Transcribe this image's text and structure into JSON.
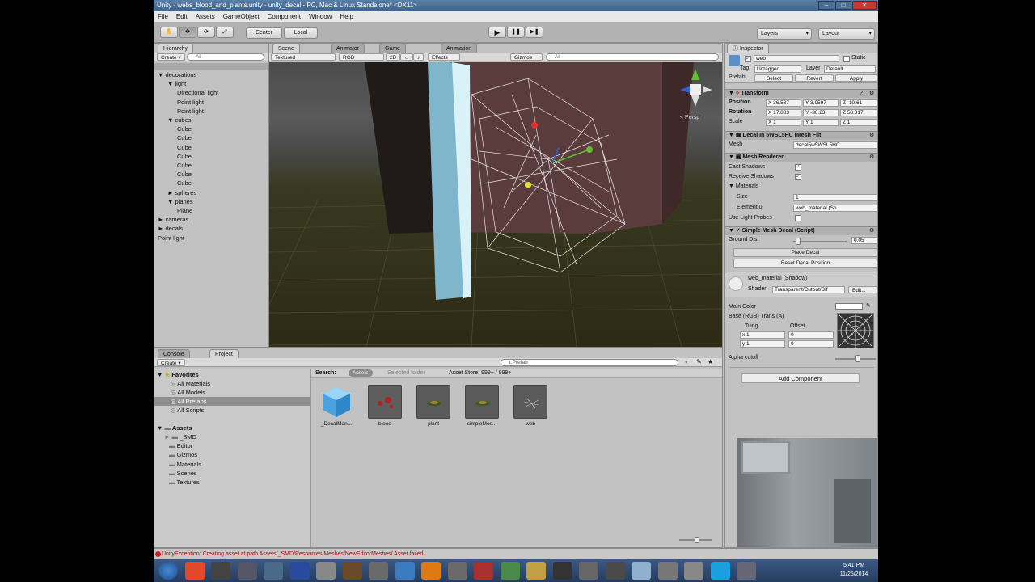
{
  "window": {
    "title": "Unity - webs_blood_and_plants.unity - unity_decal - PC, Mac & Linux Standalone* <DX11>",
    "controls": [
      "–",
      "□",
      "✕"
    ]
  },
  "menu": [
    "File",
    "Edit",
    "Assets",
    "GameObject",
    "Component",
    "Window",
    "Help"
  ],
  "toolbar": {
    "tools": [
      "hand-icon",
      "move-icon",
      "rotate-icon",
      "scale-icon"
    ],
    "pivot": "Center",
    "space": "Local",
    "play": "▶",
    "pause": "❚❚",
    "step": "▶❚",
    "layers": "Layers",
    "layout": "Layout"
  },
  "hierarchy": {
    "tab": "Hierarchy",
    "create": "Create",
    "search_placeholder": "All",
    "items": [
      {
        "label": "▼ decorations",
        "depth": 0
      },
      {
        "label": "▼ light",
        "depth": 1
      },
      {
        "label": "Directional light",
        "depth": 2
      },
      {
        "label": "Point light",
        "depth": 2
      },
      {
        "label": "Point light",
        "depth": 2
      },
      {
        "label": "▼ cubes",
        "depth": 1
      },
      {
        "label": "Cube",
        "depth": 2
      },
      {
        "label": "Cube",
        "depth": 2
      },
      {
        "label": "Cube",
        "depth": 2
      },
      {
        "label": "Cube",
        "depth": 2
      },
      {
        "label": "Cube",
        "depth": 2
      },
      {
        "label": "Cube",
        "depth": 2
      },
      {
        "label": "Cube",
        "depth": 2
      },
      {
        "label": "► spheres",
        "depth": 1
      },
      {
        "label": "▼ planes",
        "depth": 1
      },
      {
        "label": "Plane",
        "depth": 2
      },
      {
        "label": "► cameras",
        "depth": 0
      },
      {
        "label": "► decals",
        "depth": 0
      },
      {
        "label": "Point light",
        "depth": 0
      }
    ]
  },
  "scene": {
    "tabs": [
      "Scene",
      "Animator",
      "Game",
      "Animation"
    ],
    "shading": "Textured",
    "render": "RGB",
    "mode2d": "2D",
    "effects": "Effects",
    "gizmos": "Gizmos",
    "search_placeholder": "All",
    "persp": "< Persp"
  },
  "project": {
    "tabs": [
      "Console",
      "Project"
    ],
    "create": "Create",
    "search_value": "t:Prefab",
    "favorites_label": "Favorites",
    "favorites": [
      "All Materials",
      "All Models",
      "All Prefabs",
      "All Scripts"
    ],
    "assets_label": "Assets",
    "folders": [
      "_SMD",
      "Editor",
      "Gizmos",
      "Materials",
      "Scenes",
      "Textures"
    ],
    "search_label": "Search:",
    "search_scopes": [
      "Assets",
      "Selected folder",
      "Asset Store: 999+ / 999+"
    ],
    "items": [
      {
        "name": "_DecalMan...",
        "kind": "cube"
      },
      {
        "name": "blood",
        "kind": "blood"
      },
      {
        "name": "plant",
        "kind": "plant"
      },
      {
        "name": "simpleMes...",
        "kind": "plant"
      },
      {
        "name": "web",
        "kind": "web"
      }
    ]
  },
  "inspector": {
    "tab": "Inspector",
    "name": "web",
    "static": "Static",
    "tag_label": "Tag",
    "tag": "Untagged",
    "layer_label": "Layer",
    "layer": "Default",
    "prefab_label": "Prefab",
    "prefab_buttons": [
      "Select",
      "Revert",
      "Apply"
    ],
    "transform": {
      "title": "Transform",
      "position_label": "Position",
      "position": [
        "X 36.587",
        "Y 3.9597",
        "Z -10.61"
      ],
      "rotation_label": "Rotation",
      "rotation": [
        "X 17.883",
        "Y -36.23",
        "Z 58.317"
      ],
      "scale_label": "Scale",
      "scale": [
        "X 1",
        "Y 1",
        "Z 1"
      ]
    },
    "mesh_filter": {
      "title": "Decal In 5WSL5HC (Mesh Filt",
      "mesh_label": "Mesh",
      "mesh": "decal5w5WSL5HC"
    },
    "mesh_renderer": {
      "title": "Mesh Renderer",
      "cast_shadows": "Cast Shadows",
      "receive_shadows": "Receive Shadows",
      "materials": "Materials",
      "size_label": "Size",
      "size": "1",
      "element_label": "Element 0",
      "element": "web_material (Sh",
      "light_probes": "Use Light Probes"
    },
    "decal_script": {
      "title": "Simple Mesh Decal (Script)",
      "ground_dist_label": "Ground Dist",
      "ground_dist": "0.05",
      "ground_dist_fraction": 0.05,
      "place_button": "Place Decal",
      "reset_button": "Reset Decal Position"
    },
    "material": {
      "title": "web_material (Shadow)",
      "shader_label": "Shader",
      "shader": "Transparent/Cutout/Dif",
      "edit": "Edit...",
      "main_color": "Main Color",
      "base": "Base (RGB) Trans (A)",
      "tiling": "Tiling",
      "offset": "Offset",
      "tiling_x": "x 1",
      "tiling_y": "y 1",
      "offset_x": "0",
      "offset_y": "0",
      "select": "Select",
      "alpha_cutoff": "Alpha cutoff",
      "alpha_cutoff_fraction": 0.5
    },
    "add_component": "Add Component"
  },
  "status": {
    "error": "UnityException: Creating asset at path Assets/_SMD/Resources/Meshes/NewEditorMeshes/ Asset failed."
  },
  "taskbar": {
    "icons": [
      "windows-start-icon",
      "chrome-icon",
      "unity-icon",
      "app-icon",
      "app-icon",
      "photoshop-icon",
      "app-icon",
      "app-icon",
      "app-icon",
      "app-icon",
      "vlc-icon",
      "app-icon",
      "app-icon",
      "app-icon",
      "app-icon",
      "app-icon",
      "app-icon",
      "app-icon",
      "app-icon",
      "app-icon",
      "app-icon",
      "skype-icon",
      "app-icon"
    ],
    "time": "5:41 PM",
    "date": "11/25/2014"
  },
  "colors": {
    "unity_bg": "#c2c2c2",
    "selection": "#3d6fb6",
    "error": "#a01010",
    "gizmo_red": "#e03030",
    "gizmo_green": "#60c030",
    "gizmo_blue": "#3060e0",
    "gizmo_yellow": "#e0e030"
  }
}
